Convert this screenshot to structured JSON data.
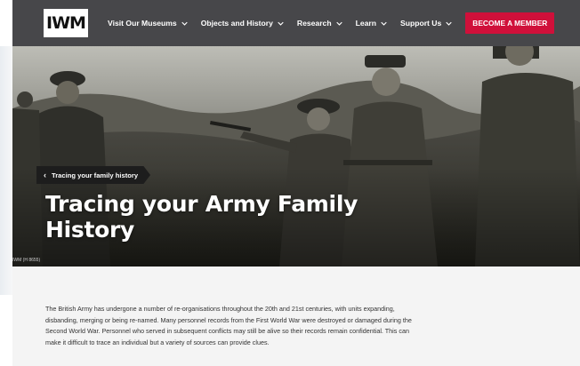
{
  "logo": {
    "text": "IWM"
  },
  "nav": {
    "items": [
      {
        "label": "Visit Our Museums"
      },
      {
        "label": "Objects and History"
      },
      {
        "label": "Research"
      },
      {
        "label": "Learn"
      },
      {
        "label": "Support Us"
      }
    ],
    "cta_label": "BECOME A MEMBER"
  },
  "hero": {
    "breadcrumb": "Tracing your family history",
    "title": "Tracing your Army Family History",
    "credit": "IWM (H 8655)"
  },
  "content": {
    "intro": "The British Army has undergone a number of re-organisations throughout the 20th and 21st centuries, with units expanding, disbanding, merging or being re-named. Many personnel records from the First World War were destroyed or damaged during the Second World War. Personnel who served in subsequent conflicts may still be alive so their records remain confidential. This can make it difficult to trace an individual but a variety of sources can provide clues."
  },
  "colors": {
    "nav_bg": "#47474a",
    "cta_bg": "#d0103a",
    "content_bg": "#f4f4f4"
  }
}
